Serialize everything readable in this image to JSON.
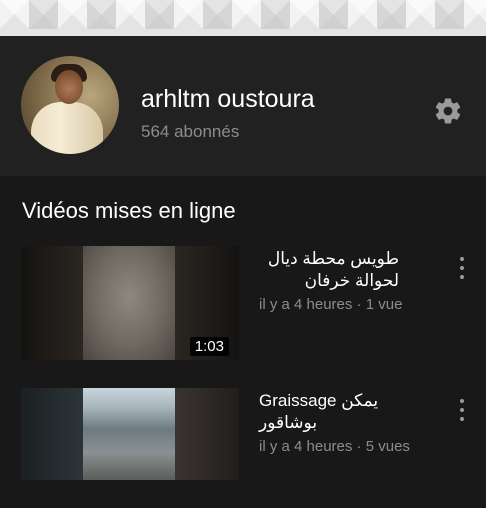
{
  "channel": {
    "name": "arhltm oustoura",
    "subscribers": "564 abonnés"
  },
  "section": {
    "title": "Vidéos mises en ligne"
  },
  "videos": [
    {
      "title": "طويس محطة ديال لحوالة خرفان",
      "meta": "il y a 4 heures · 1 vue",
      "duration": "1:03"
    },
    {
      "title": "Graissage يمكن بوشاقور",
      "meta": "il y a 4 heures · 5 vues",
      "duration": ""
    }
  ],
  "icons": {
    "settings": "gear-icon",
    "more": "more-vert-icon"
  },
  "colors": {
    "background": "#181818",
    "header": "#212121",
    "secondary_text": "#8c8c8c"
  }
}
